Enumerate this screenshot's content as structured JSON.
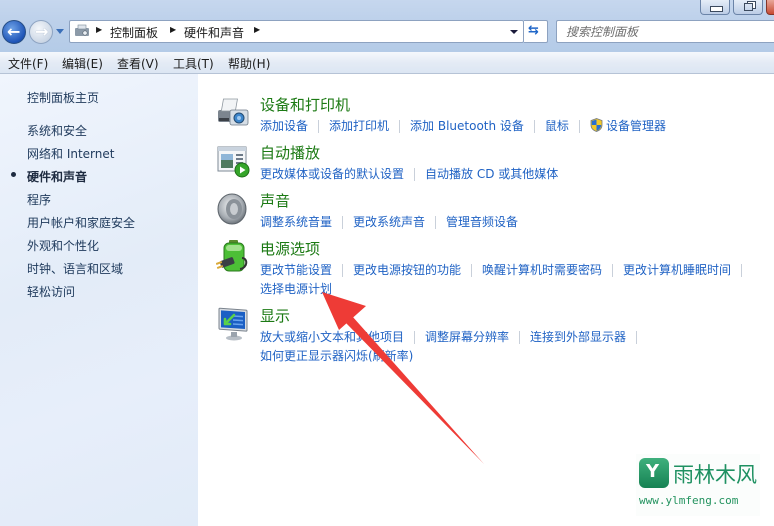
{
  "window": {
    "controls": [
      "minimize",
      "restore",
      "close"
    ]
  },
  "navigation": {
    "back_icon": "back-arrow-icon",
    "forward_icon": "forward-arrow-icon",
    "breadcrumb": [
      "控制面板",
      "硬件和声音"
    ],
    "refresh_icon": "refresh-icon",
    "search_placeholder": "搜索控制面板"
  },
  "menubar": {
    "items": [
      "文件(F)",
      "编辑(E)",
      "查看(V)",
      "工具(T)",
      "帮助(H)"
    ]
  },
  "sidebar": {
    "home": "控制面板主页",
    "items": [
      {
        "label": "系统和安全",
        "active": false
      },
      {
        "label": "网络和 Internet",
        "active": false
      },
      {
        "label": "硬件和声音",
        "active": true
      },
      {
        "label": "程序",
        "active": false
      },
      {
        "label": "用户帐户和家庭安全",
        "active": false
      },
      {
        "label": "外观和个性化",
        "active": false
      },
      {
        "label": "时钟、语言和区域",
        "active": false
      },
      {
        "label": "轻松访问",
        "active": false
      }
    ]
  },
  "categories": [
    {
      "title": "设备和打印机",
      "icon": "printer-camera-icon",
      "links": [
        "添加设备",
        "添加打印机",
        "添加 Bluetooth 设备",
        "鼠标",
        "设备管理器"
      ],
      "shielded_link": "设备管理器"
    },
    {
      "title": "自动播放",
      "icon": "autoplay-icon",
      "links": [
        "更改媒体或设备的默认设置",
        "自动播放 CD 或其他媒体"
      ]
    },
    {
      "title": "声音",
      "icon": "speaker-icon",
      "links": [
        "调整系统音量",
        "更改系统声音",
        "管理音频设备"
      ]
    },
    {
      "title": "电源选项",
      "icon": "battery-plug-icon",
      "links": [
        "更改节能设置",
        "更改电源按钮的功能",
        "唤醒计算机时需要密码",
        "更改计算机睡眠时间"
      ],
      "links_line2": [
        "选择电源计划"
      ]
    },
    {
      "title": "显示",
      "icon": "monitor-icon",
      "links": [
        "放大或缩小文本和其他项目",
        "调整屏幕分辨率",
        "连接到外部显示器"
      ],
      "links_line2": [
        "如何更正显示器闪烁(刷新率)"
      ]
    }
  ],
  "annotation": {
    "type": "red-arrow",
    "points_to": "选择电源计划",
    "color": "#ee3b36"
  },
  "watermark": {
    "name": "雨林木风",
    "url": "www.ylmfeng.com"
  }
}
